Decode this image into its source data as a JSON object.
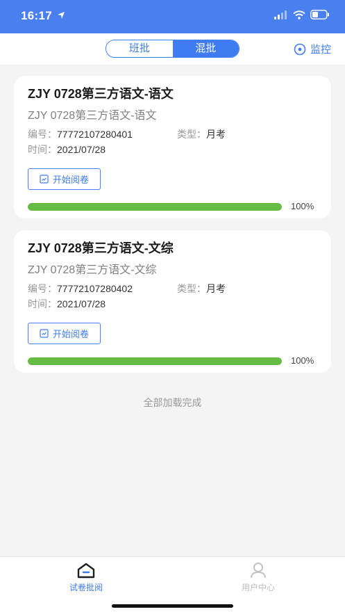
{
  "status_bar": {
    "time": "16:17"
  },
  "header": {
    "segments": [
      "班批",
      "混批"
    ],
    "active_segment": "混批",
    "monitor_label": "监控"
  },
  "cards": [
    {
      "title": "ZJY 0728第三方语文-语文",
      "subtitle": "ZJY 0728第三方语文-语文",
      "code_label": "编号：",
      "code_value": "77772107280401",
      "type_label": "类型：",
      "type_value": "月考",
      "time_label": "时间：",
      "time_value": "2021/07/28",
      "start_label": "开始阅卷",
      "progress": 1.0,
      "progress_text": "100%"
    },
    {
      "title": "ZJY 0728第三方语文-文综",
      "subtitle": "ZJY 0728第三方语文-文综",
      "code_label": "编号：",
      "code_value": "77772107280402",
      "type_label": "类型：",
      "type_value": "月考",
      "time_label": "时间：",
      "time_value": "2021/07/28",
      "start_label": "开始阅卷",
      "progress": 1.0,
      "progress_text": "100%"
    }
  ],
  "list_footer": "全部加载完成",
  "tabbar": {
    "items": [
      {
        "label": "试卷批阅",
        "icon": "house-icon",
        "active": true
      },
      {
        "label": "用户中心",
        "icon": "user-icon",
        "active": false
      }
    ]
  },
  "colors": {
    "accent": "#3f7cf2",
    "status_bar": "#4a7ff0",
    "progress": "#66bb44"
  }
}
